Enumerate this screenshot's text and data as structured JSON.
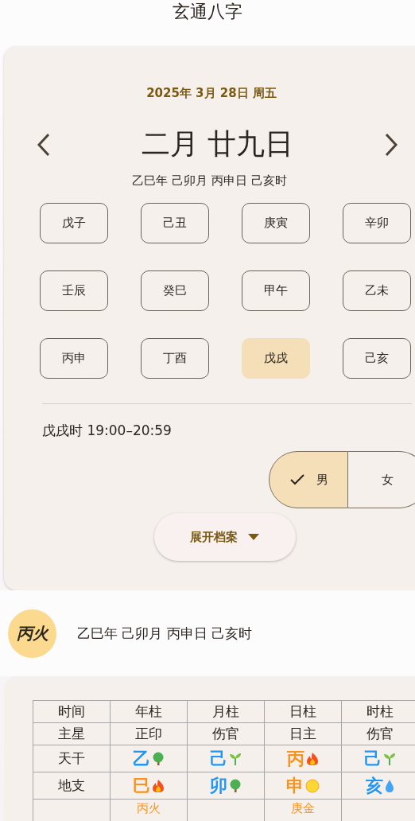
{
  "app_title": "玄通八字",
  "date": {
    "solar": "2025年 3月 28日 周五",
    "lunar": "二月 廿九日",
    "ganzhi": "乙巳年 己卯月 丙申日 己亥时"
  },
  "hours": [
    {
      "label": "戊子",
      "selected": false
    },
    {
      "label": "己丑",
      "selected": false
    },
    {
      "label": "庚寅",
      "selected": false
    },
    {
      "label": "辛卯",
      "selected": false
    },
    {
      "label": "壬辰",
      "selected": false
    },
    {
      "label": "癸巳",
      "selected": false
    },
    {
      "label": "甲午",
      "selected": false
    },
    {
      "label": "乙未",
      "selected": false
    },
    {
      "label": "丙申",
      "selected": false
    },
    {
      "label": "丁酉",
      "selected": false
    },
    {
      "label": "戊戌",
      "selected": true
    },
    {
      "label": "己亥",
      "selected": false
    }
  ],
  "hour_range": "戊戌时 19:00–20:59",
  "gender": [
    {
      "label": "男",
      "selected": true
    },
    {
      "label": "女",
      "selected": false
    }
  ],
  "expand_button": "展开档案",
  "summary": {
    "day_master": "丙火",
    "ganzhi": "乙巳年 己卯月 丙申日 己亥时"
  },
  "table": {
    "columns": [
      "时间",
      "年柱",
      "月柱",
      "日柱",
      "时柱"
    ],
    "rows": [
      {
        "kind": "text",
        "cells": [
          {
            "text": "主星"
          },
          {
            "text": "正印"
          },
          {
            "text": "伤官"
          },
          {
            "text": "日主"
          },
          {
            "text": "伤官"
          }
        ]
      },
      {
        "kind": "element",
        "cells": [
          {
            "text": "天干"
          },
          {
            "text": "乙",
            "color": "#2196f3",
            "kind": "tree"
          },
          {
            "text": "己",
            "color": "#2196f3",
            "kind": "sprout"
          },
          {
            "text": "丙",
            "color": "#f7931e",
            "kind": "fire"
          },
          {
            "text": "己",
            "color": "#2196f3",
            "kind": "sprout"
          }
        ]
      },
      {
        "kind": "element",
        "cells": [
          {
            "text": "地支"
          },
          {
            "text": "巳",
            "color": "#f7931e",
            "kind": "fire"
          },
          {
            "text": "卯",
            "color": "#2196f3",
            "kind": "tree"
          },
          {
            "text": "申",
            "color": "#f7931e",
            "kind": "metal"
          },
          {
            "text": "亥",
            "color": "#2196f3",
            "kind": "water"
          }
        ]
      },
      {
        "kind": "hidden",
        "cells": [
          {
            "text": ""
          },
          {
            "text": "丙火",
            "color": "#f7931e"
          },
          {
            "text": ""
          },
          {
            "text": "庚金",
            "color": "#f7931e"
          },
          {
            "text": ""
          }
        ]
      }
    ]
  }
}
